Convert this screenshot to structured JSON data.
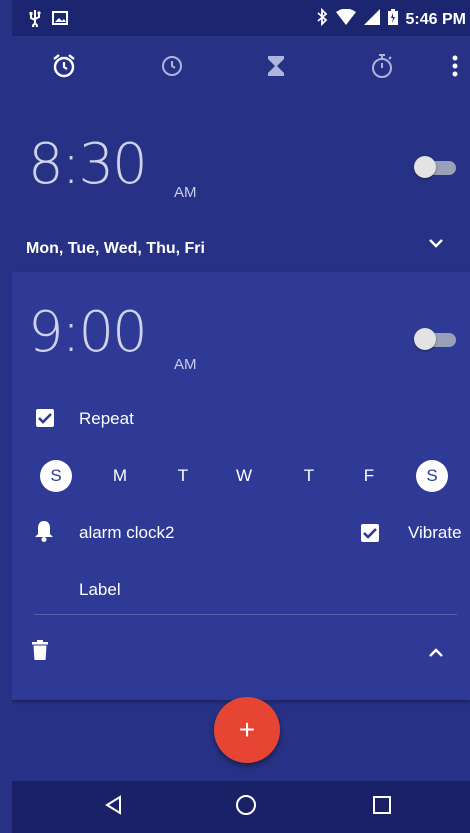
{
  "status_bar": {
    "time": "5:46 PM",
    "icons": [
      "usb-icon",
      "image-icon",
      "bluetooth-icon",
      "wifi-icon",
      "signal-icon",
      "battery-icon"
    ]
  },
  "tabs": [
    {
      "name": "alarm",
      "icon": "alarm-icon"
    },
    {
      "name": "clock",
      "icon": "clock-icon"
    },
    {
      "name": "timer",
      "icon": "hourglass-icon"
    },
    {
      "name": "stopwatch",
      "icon": "stopwatch-icon"
    },
    {
      "name": "more",
      "icon": "more-vert-icon"
    }
  ],
  "alarm1": {
    "time": "8:30",
    "ampm": "AM",
    "enabled": false,
    "days": "Mon, Tue, Wed, Thu, Fri"
  },
  "alarm2": {
    "time": "9:00",
    "ampm": "AM",
    "enabled": false,
    "repeat_label": "Repeat",
    "repeat_checked": true,
    "week_days": [
      {
        "letter": "S",
        "selected": true
      },
      {
        "letter": "M",
        "selected": false
      },
      {
        "letter": "T",
        "selected": false
      },
      {
        "letter": "W",
        "selected": false
      },
      {
        "letter": "T",
        "selected": false
      },
      {
        "letter": "F",
        "selected": false
      },
      {
        "letter": "S",
        "selected": true
      }
    ],
    "ringtone": "alarm clock2",
    "vibrate_label": "Vibrate",
    "vibrate_checked": true,
    "label_text": "Label"
  },
  "fab": {
    "symbol": "+"
  },
  "colors": {
    "background": "#273286",
    "card": "#2e3a96",
    "status_bar": "#1c2670",
    "nav_bar": "#1a2166",
    "fab": "#e64534"
  }
}
